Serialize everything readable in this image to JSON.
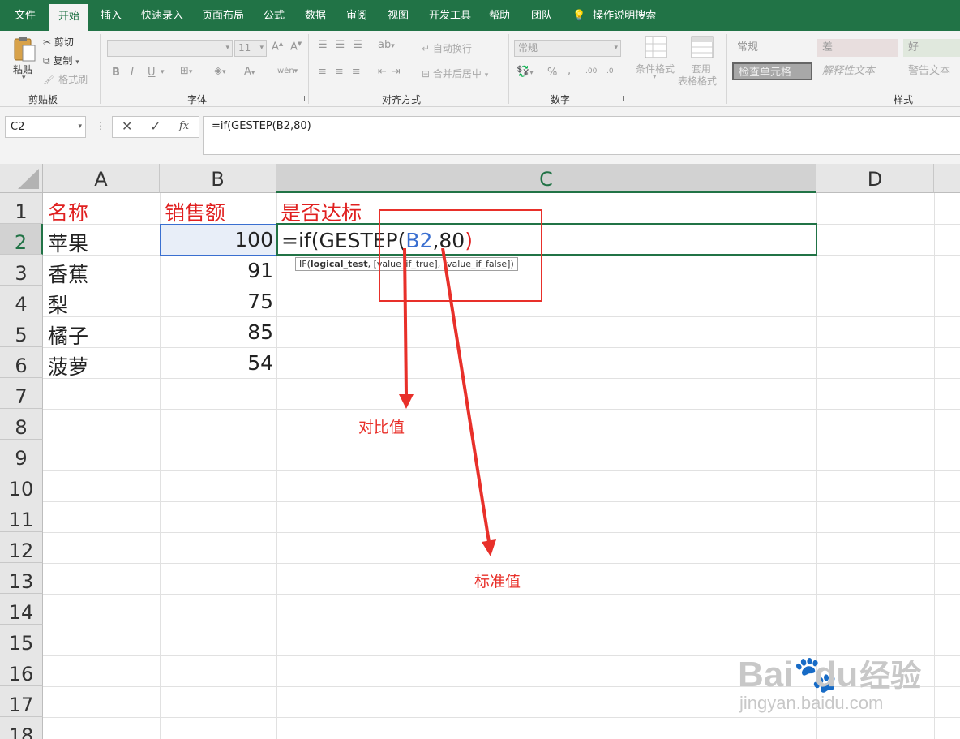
{
  "menu": {
    "items": [
      "文件",
      "开始",
      "插入",
      "快速录入",
      "页面布局",
      "公式",
      "数据",
      "审阅",
      "视图",
      "开发工具",
      "帮助",
      "团队"
    ],
    "active_index": 1,
    "search_label": "操作说明搜索"
  },
  "ribbon": {
    "clipboard": {
      "paste": "粘贴",
      "cut": "剪切",
      "copy": "复制",
      "format_painter": "格式刷",
      "label": "剪贴板"
    },
    "font": {
      "size": "11",
      "label": "字体",
      "bold": "B",
      "italic": "I",
      "underline": "U",
      "font_color": "A",
      "phonetic": "wén"
    },
    "alignment": {
      "wrap_text": "自动换行",
      "merge_center": "合并后居中",
      "label": "对齐方式"
    },
    "number": {
      "format": "常规",
      "percent": "%",
      "comma": ",",
      "inc_decimal": ".00",
      "dec_decimal": ".0",
      "label": "数字"
    },
    "styles": {
      "conditional": "条件格式",
      "table_format_1": "套用",
      "table_format_2": "表格格式",
      "cells": [
        "常规",
        "差",
        "好",
        "检查单元格",
        "解释性文本",
        "警告文本"
      ],
      "label": "样式"
    }
  },
  "formula_bar": {
    "name_box": "C2",
    "cancel": "✕",
    "enter": "✓",
    "fx": "fx",
    "formula": "=if(GESTEP(B2,80)"
  },
  "sheet": {
    "columns": [
      "A",
      "B",
      "C",
      "D"
    ],
    "rows": [
      "1",
      "2",
      "3",
      "4",
      "5",
      "6",
      "7",
      "8",
      "9",
      "10",
      "11",
      "12",
      "13",
      "14",
      "15",
      "16",
      "17",
      "18"
    ],
    "headers": [
      "名称",
      "销售额",
      "是否达标"
    ],
    "data": [
      {
        "name": "苹果",
        "sales": "100"
      },
      {
        "name": "香蕉",
        "sales": "91"
      },
      {
        "name": "梨",
        "sales": "75"
      },
      {
        "name": "橘子",
        "sales": "85"
      },
      {
        "name": "菠萝",
        "sales": "54"
      }
    ],
    "editing_formula": {
      "prefix": "=if(GESTEP(",
      "ref": "B2",
      "comma": ",",
      "threshold": "80",
      "close": ")"
    },
    "tooltip": {
      "func": "IF(",
      "arg1": "logical_test",
      "rest": ", [value_if_true], [value_if_false])"
    }
  },
  "annotations": {
    "label_compare": "对比值",
    "label_standard": "标准值",
    "color": "#e8302a"
  },
  "watermark": {
    "brand": "Bai",
    "brand2": "du",
    "product": "经验",
    "url": "jingyan.baidu.com"
  },
  "colors": {
    "excel_green": "#217346",
    "ref_blue": "#3a6fd0",
    "red_text": "#e02020"
  }
}
